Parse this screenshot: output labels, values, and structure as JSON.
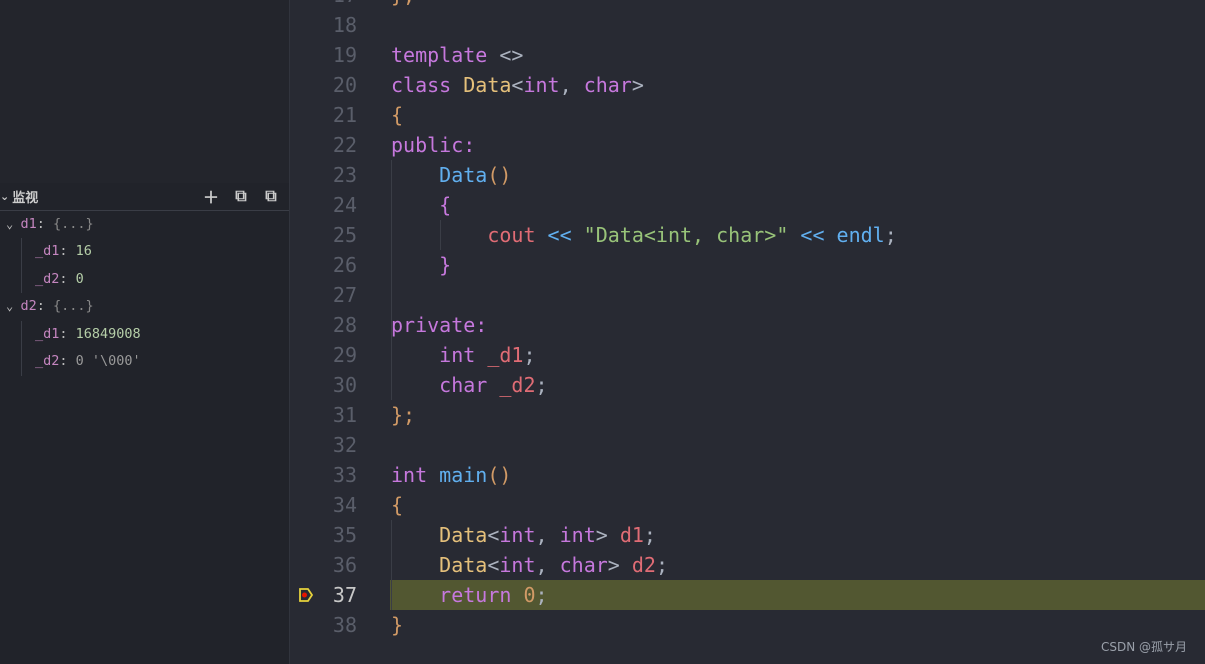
{
  "watch": {
    "title": "监视",
    "icons": [
      "plus-icon",
      "collapse-all-icon",
      "remove-all-icon"
    ],
    "items": [
      {
        "level": 0,
        "name": "d1",
        "value": "{...}",
        "expanded": true
      },
      {
        "level": 1,
        "name": "_d1",
        "value": "16"
      },
      {
        "level": 1,
        "name": "_d2",
        "value": "0"
      },
      {
        "level": 0,
        "name": "d2",
        "value": "{...}",
        "expanded": true
      },
      {
        "level": 1,
        "name": "_d1",
        "value": "16849008"
      },
      {
        "level": 1,
        "name": "_d2",
        "value": "0 '\\000'",
        "dim": true
      }
    ]
  },
  "editor": {
    "current_line": 37,
    "first_line": 17,
    "lines": [
      [
        [
          "};",
          "br"
        ]
      ],
      [],
      [
        [
          "template ",
          "kw"
        ],
        [
          "<>",
          "op"
        ]
      ],
      [
        [
          "class ",
          "kw"
        ],
        [
          "Data",
          "ty"
        ],
        [
          "<",
          "op"
        ],
        [
          "int",
          "kw"
        ],
        [
          ", ",
          "pu"
        ],
        [
          "char",
          "kw"
        ],
        [
          ">",
          "op"
        ]
      ],
      [
        [
          "{",
          "br"
        ]
      ],
      [
        [
          "public",
          "kw"
        ],
        [
          ":",
          "kw"
        ]
      ],
      [
        [
          "    ",
          "pu"
        ],
        [
          "Data",
          "fn"
        ],
        [
          "()",
          "br"
        ]
      ],
      [
        [
          "    ",
          "pu"
        ],
        [
          "{",
          "br2"
        ]
      ],
      [
        [
          "        ",
          "pu"
        ],
        [
          "cout",
          "va"
        ],
        [
          " << ",
          "fn"
        ],
        [
          "\"Data<int, char>\"",
          "st"
        ],
        [
          " << ",
          "fn"
        ],
        [
          "endl",
          "fn"
        ],
        [
          ";",
          "pu"
        ]
      ],
      [
        [
          "    ",
          "pu"
        ],
        [
          "}",
          "br2"
        ]
      ],
      [],
      [
        [
          "private",
          "kw"
        ],
        [
          ":",
          "kw"
        ]
      ],
      [
        [
          "    ",
          "pu"
        ],
        [
          "int ",
          "kw"
        ],
        [
          "_d1",
          "va"
        ],
        [
          ";",
          "pu"
        ]
      ],
      [
        [
          "    ",
          "pu"
        ],
        [
          "char ",
          "kw"
        ],
        [
          "_d2",
          "va"
        ],
        [
          ";",
          "pu"
        ]
      ],
      [
        [
          "};",
          "br"
        ]
      ],
      [],
      [
        [
          "int ",
          "kw"
        ],
        [
          "main",
          "fn"
        ],
        [
          "()",
          "br"
        ]
      ],
      [
        [
          "{",
          "br"
        ]
      ],
      [
        [
          "    ",
          "pu"
        ],
        [
          "Data",
          "ty"
        ],
        [
          "<",
          "op"
        ],
        [
          "int",
          "kw"
        ],
        [
          ", ",
          "pu"
        ],
        [
          "int",
          "kw"
        ],
        [
          "> ",
          "op"
        ],
        [
          "d1",
          "va"
        ],
        [
          ";",
          "pu"
        ]
      ],
      [
        [
          "    ",
          "pu"
        ],
        [
          "Data",
          "ty"
        ],
        [
          "<",
          "op"
        ],
        [
          "int",
          "kw"
        ],
        [
          ", ",
          "pu"
        ],
        [
          "char",
          "kw"
        ],
        [
          "> ",
          "op"
        ],
        [
          "d2",
          "va"
        ],
        [
          ";",
          "pu"
        ]
      ],
      [
        [
          "    ",
          "pu"
        ],
        [
          "return ",
          "kw"
        ],
        [
          "0",
          "nm"
        ],
        [
          ";",
          "pu"
        ]
      ],
      [
        [
          "}",
          "br"
        ]
      ]
    ]
  },
  "watermark": "CSDN @孤サ月"
}
